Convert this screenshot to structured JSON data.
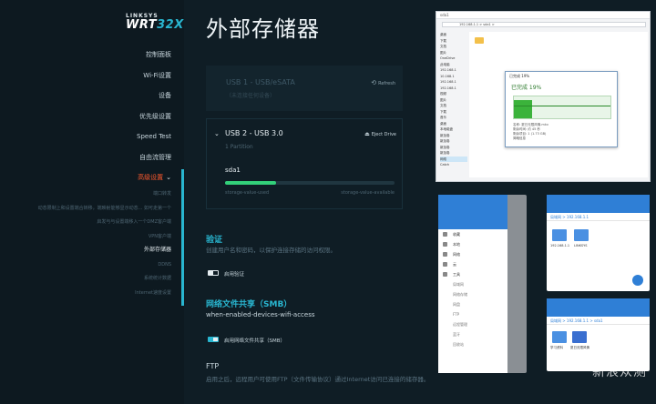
{
  "brand": {
    "name": "LINKSYS",
    "model_prefix": "WRT",
    "model_suffix": "32X"
  },
  "sidebar": {
    "items": [
      {
        "label": "控制面板"
      },
      {
        "label": "Wi-Fi设置"
      },
      {
        "label": "设备"
      },
      {
        "label": "优先级设置"
      },
      {
        "label": "Speed Test"
      },
      {
        "label": "自由流管理"
      },
      {
        "label": "高级设置",
        "chevron": "⌄"
      }
    ],
    "sub_items": [
      {
        "label": "端口转发"
      },
      {
        "label": "动态限制上和设置端合转移，端映射能够显示动态... 如可走第一个"
      },
      {
        "label": "启发与与设置端移入一个DMZ客户端"
      },
      {
        "label": "VPN客户端"
      },
      {
        "label": "外部存储器"
      },
      {
        "label": "DDNS"
      },
      {
        "label": "系统统计数据"
      },
      {
        "label": "Internet速度设置"
      }
    ]
  },
  "main": {
    "title": "外部存储器",
    "usb1": {
      "title": "USB 1 - USB/eSATA",
      "subtitle": "（未连接任何设备）",
      "refresh": "Refresh"
    },
    "usb2": {
      "title": "USB 2 - USB 3.0",
      "partitions": "1 Partition",
      "eject": "Eject Drive",
      "drive": "sda1",
      "used_fraction": 0.3,
      "used_label": "storage-value-used",
      "available_label": "storage-value-available"
    },
    "auth": {
      "title": "验证",
      "desc": "创建用户名和密码，以保护连接存储的访问权限。",
      "toggle_label": "启用验证",
      "enabled": false
    },
    "smb": {
      "title": "网络文件共享（SMB）",
      "subtitle": "when-enabled-devices-wifi-access",
      "toggle_label": "启用网络文件共享（SMB）",
      "enabled": true
    },
    "ftp": {
      "title": "FTP",
      "desc": "启用之后，远程用户可使用FTP（文件传输协议）通过Internet访问已连接的储存器。"
    }
  },
  "screenshots": {
    "explorer": {
      "title": "sda1",
      "path": "192.168.1.1 > sda1 >",
      "tree": [
        "桌面",
        "下载",
        "文档",
        "图片",
        "OneDrive",
        "此电脑",
        "192.168.1",
        "10.168.1",
        "192.168.1",
        "192.168.1",
        "视频",
        "图片",
        "文档",
        "下载",
        "音乐",
        "桌面",
        "本地磁盘",
        "新加卷",
        "新加卷",
        "新加卷",
        "新加卷",
        "网络",
        "Catch"
      ],
      "copy_dialog": {
        "title": "已完成 19%",
        "progress_text": "已完成 19%",
        "progress": 0.19,
        "info_lines": [
          "名称: 夏日无限风情.mkv",
          "剩余时间: 约 45 秒",
          "剩余项目: 1 (1.73 GB)"
        ],
        "details": "简略信息"
      }
    },
    "phone_drawer": {
      "items": [
        "收藏",
        "本地",
        "网络",
        "云",
        "工具"
      ],
      "sub_items": [
        "局域网",
        "网络存储",
        "网盘",
        "FTP",
        "远程管理",
        "蓝牙",
        "回收站"
      ]
    },
    "phone_a": {
      "crumb": "局域网 > 192.168.1.1",
      "folders": [
        "192.168.1.1",
        "LINKSYS"
      ]
    },
    "phone_b": {
      "crumb": "局域网 > 192.168.1.1 > sda1",
      "folders": [
        "学习资料",
        "夏日无限风情"
      ]
    }
  },
  "watermark": "新浪众测"
}
